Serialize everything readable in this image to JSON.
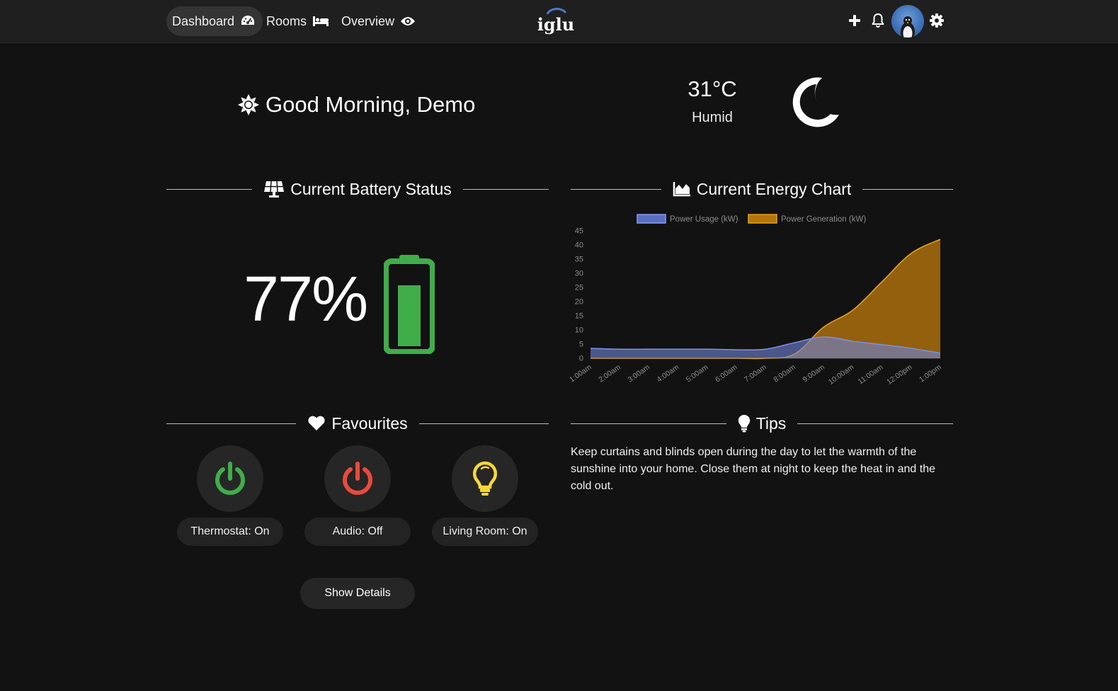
{
  "nav": {
    "items": [
      {
        "label": "Dashboard",
        "icon": "tachometer-icon",
        "active": true
      },
      {
        "label": "Rooms",
        "icon": "bed-icon",
        "active": false
      },
      {
        "label": "Overview",
        "icon": "eye-icon",
        "active": false
      }
    ],
    "logo_text": "iglu",
    "actions": [
      "plus-icon",
      "bell-icon",
      "avatar",
      "gear-icon"
    ]
  },
  "greeting": {
    "text": "Good Morning, Demo",
    "icon": "sun-icon"
  },
  "weather": {
    "temperature": "31°C",
    "condition": "Humid",
    "icon": "moon-icon"
  },
  "battery": {
    "title": "Current Battery Status",
    "icon": "solar-panel-icon",
    "percent_text": "77%",
    "level": 0.77,
    "color": "#3fae49"
  },
  "energy": {
    "title": "Current Energy Chart",
    "icon": "area-chart-icon"
  },
  "chart_data": {
    "type": "area",
    "x": [
      "1:00am",
      "2:00am",
      "3:00am",
      "4:00am",
      "5:00am",
      "6:00am",
      "7:00am",
      "8:00am",
      "9:00am",
      "10:00am",
      "11:00am",
      "12:00pm",
      "1:00pm"
    ],
    "series": [
      {
        "name": "Power Usage (kW)",
        "color": "#5b6fc0",
        "values": [
          3.5,
          3.2,
          3.2,
          3.2,
          3.2,
          3.0,
          3.2,
          5.5,
          7.5,
          6.0,
          4.8,
          3.5,
          1.8
        ]
      },
      {
        "name": "Power Generation (kW)",
        "color": "#d99a1c",
        "values": [
          0,
          0,
          0,
          0,
          0,
          0,
          0,
          1.5,
          11,
          17,
          27,
          37,
          42
        ]
      }
    ],
    "ylim": [
      0,
      45
    ],
    "yticks": [
      0,
      5,
      10,
      15,
      20,
      25,
      30,
      35,
      40,
      45
    ],
    "legend": "top-center",
    "grid": false
  },
  "favourites": {
    "title": "Favourites",
    "icon": "heart-icon",
    "items": [
      {
        "label": "Thermostat: On",
        "icon": "power-icon",
        "color": "#3fae49"
      },
      {
        "label": "Audio: Off",
        "icon": "power-icon",
        "color": "#e84a3c"
      },
      {
        "label": "Living Room: On",
        "icon": "lightbulb-icon",
        "color": "#f7d838"
      }
    ],
    "button_label": "Show Details"
  },
  "tips": {
    "title": "Tips",
    "icon": "lightbulb-icon",
    "text": "Keep curtains and blinds open during the day to let the warmth of the sunshine into your home. Close them at night to keep the heat in and the cold out."
  }
}
